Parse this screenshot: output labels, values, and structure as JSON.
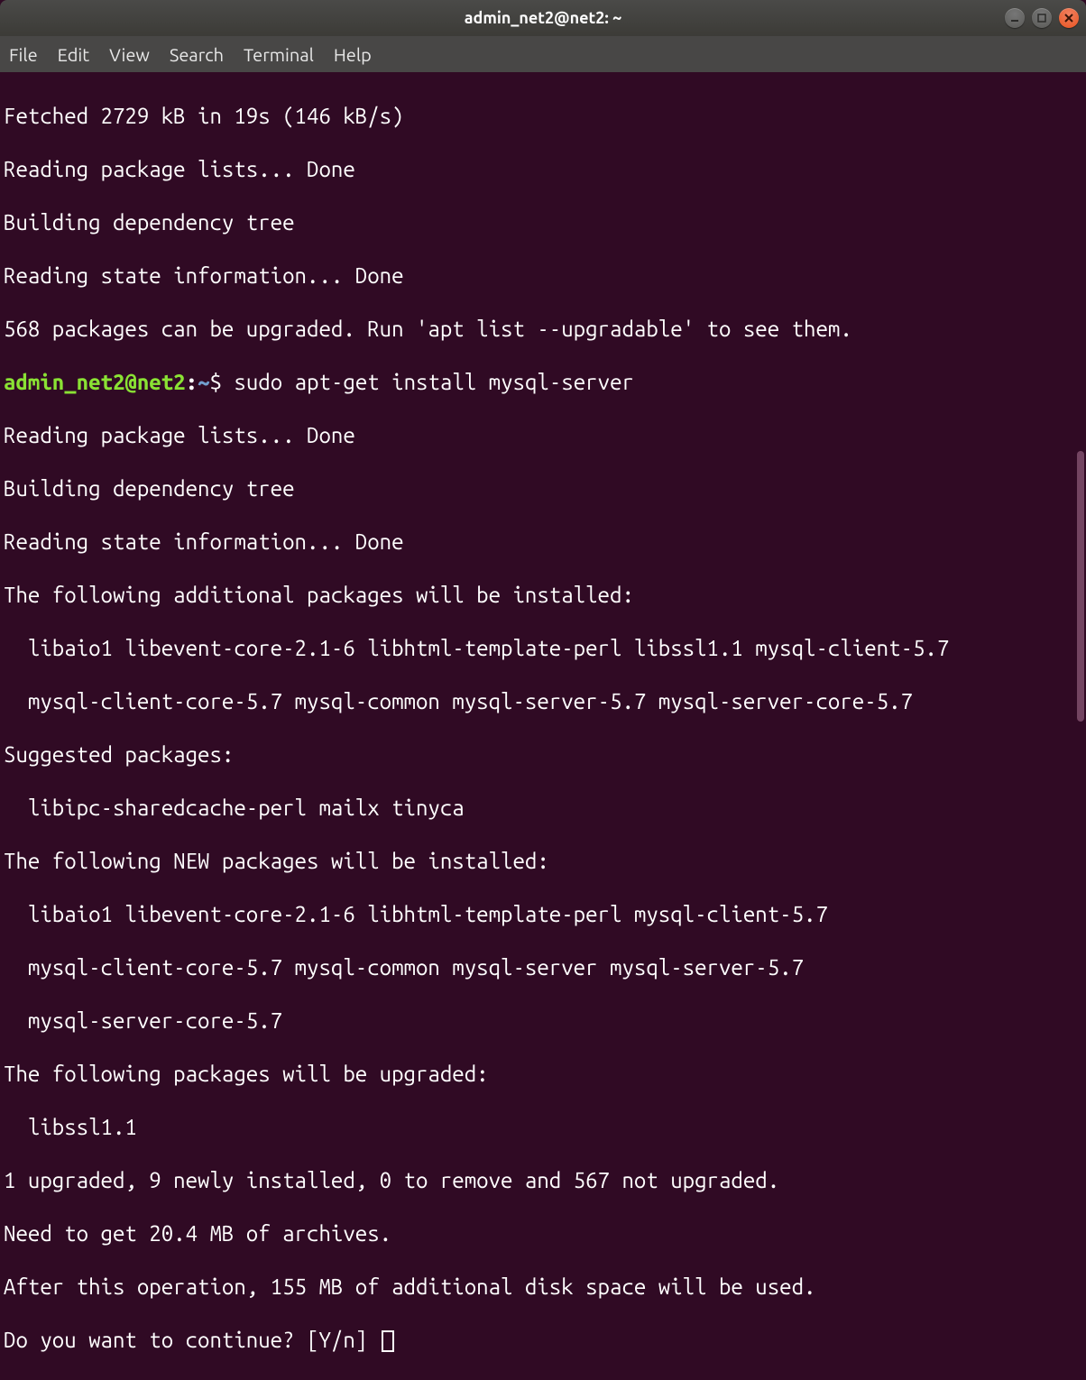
{
  "window": {
    "title": "admin_net2@net2: ~"
  },
  "menu": {
    "file": "File",
    "edit": "Edit",
    "view": "View",
    "search": "Search",
    "terminal": "Terminal",
    "help": "Help"
  },
  "prompt": {
    "user": "admin_net2",
    "host": "net2",
    "path": "~",
    "sigil": "$"
  },
  "lines": {
    "l0": "Fetched 2729 kB in 19s (146 kB/s)",
    "l1": "Reading package lists... Done",
    "l2": "Building dependency tree",
    "l3": "Reading state information... Done",
    "l4": "568 packages can be upgraded. Run 'apt list --upgradable' to see them.",
    "cmd": " sudo apt-get install mysql-server",
    "l6": "Reading package lists... Done",
    "l7": "Building dependency tree",
    "l8": "Reading state information... Done",
    "l9": "The following additional packages will be installed:",
    "l10": "  libaio1 libevent-core-2.1-6 libhtml-template-perl libssl1.1 mysql-client-5.7",
    "l11": "  mysql-client-core-5.7 mysql-common mysql-server-5.7 mysql-server-core-5.7",
    "l12": "Suggested packages:",
    "l13": "  libipc-sharedcache-perl mailx tinyca",
    "l14": "The following NEW packages will be installed:",
    "l15": "  libaio1 libevent-core-2.1-6 libhtml-template-perl mysql-client-5.7",
    "l16": "  mysql-client-core-5.7 mysql-common mysql-server mysql-server-5.7",
    "l17": "  mysql-server-core-5.7",
    "l18": "The following packages will be upgraded:",
    "l19": "  libssl1.1",
    "l20": "1 upgraded, 9 newly installed, 0 to remove and 567 not upgraded.",
    "l21": "Need to get 20.4 MB of archives.",
    "l22": "After this operation, 155 MB of additional disk space will be used.",
    "l23": "Do you want to continue? [Y/n] "
  }
}
